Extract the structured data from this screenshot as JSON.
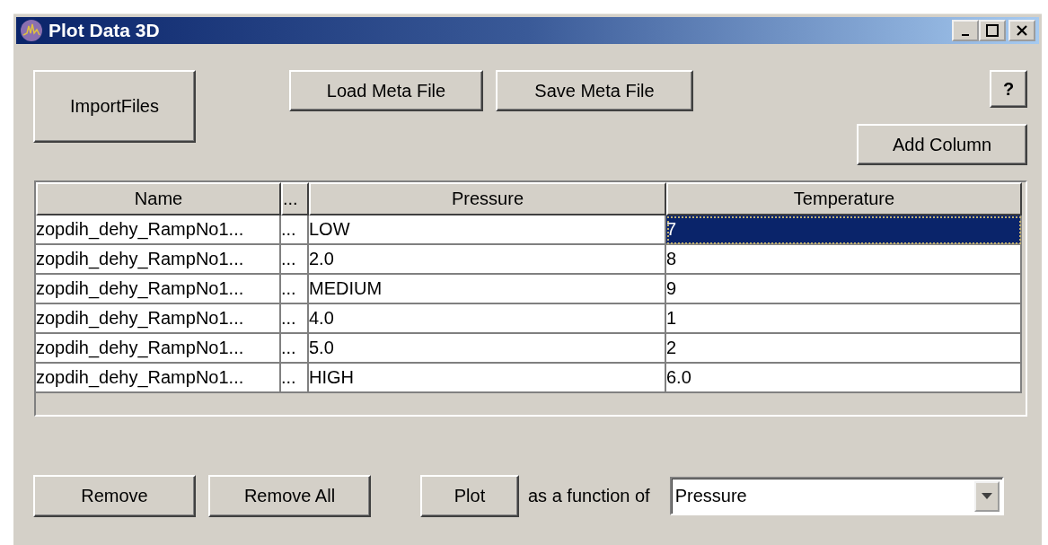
{
  "window": {
    "title": "Plot Data 3D"
  },
  "toolbar": {
    "import_button": "ImportFiles",
    "load_button": "Load Meta File",
    "save_button": "Save Meta File",
    "help_button": "?",
    "add_column_button": "Add Column"
  },
  "table": {
    "columns": [
      "Name",
      "...",
      "Pressure",
      "Temperature"
    ],
    "rows": [
      {
        "name": "zopdih_dehy_RampNo1...",
        "column_2": "...",
        "pressure": "LOW",
        "temperature": "7",
        "selected": true
      },
      {
        "name": "zopdih_dehy_RampNo1...",
        "column_2": "...",
        "pressure": "2.0",
        "temperature": "8",
        "selected": false
      },
      {
        "name": "zopdih_dehy_RampNo1...",
        "column_2": "...",
        "pressure": "MEDIUM",
        "temperature": "9",
        "selected": false
      },
      {
        "name": "zopdih_dehy_RampNo1...",
        "column_2": "...",
        "pressure": "4.0",
        "temperature": "1",
        "selected": false
      },
      {
        "name": "zopdih_dehy_RampNo1...",
        "column_2": "...",
        "pressure": "5.0",
        "temperature": "2",
        "selected": false
      },
      {
        "name": "zopdih_dehy_RampNo1...",
        "column_2": "...",
        "pressure": "HIGH",
        "temperature": "6.0",
        "selected": false
      }
    ]
  },
  "footer": {
    "remove_button": "Remove",
    "remove_all_button": "Remove All",
    "plot_button": "Plot",
    "function_label": "as a function of",
    "function_select": {
      "value": "Pressure"
    }
  }
}
